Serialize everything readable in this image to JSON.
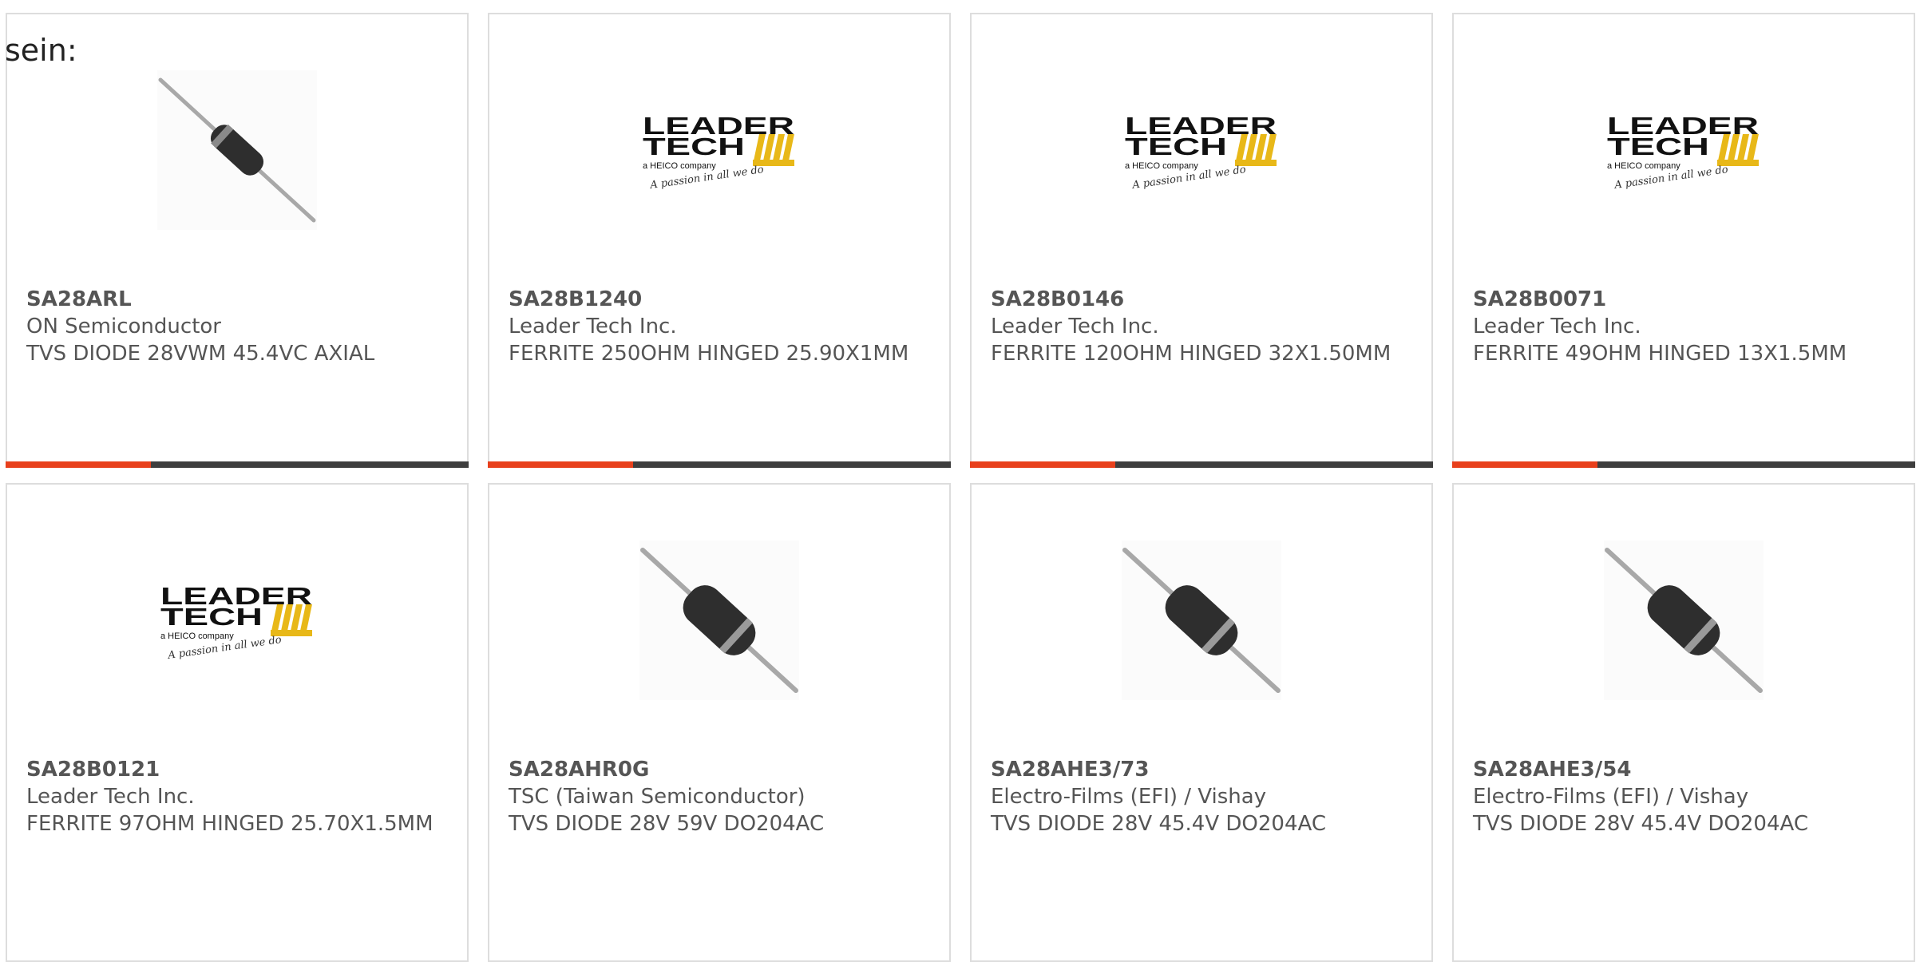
{
  "page": {
    "heading": "sein:"
  },
  "colors": {
    "accent": "#e8401c",
    "bar": "#3e3e3e",
    "card_border": "#dddddd",
    "text": "#555555",
    "leader_tech_yellow": "#e8b818"
  },
  "products": [
    {
      "part_number": "SA28ARL",
      "manufacturer": "ON Semiconductor",
      "description": "TVS DIODE 28VWM 45.4VC AXIAL",
      "image": "axial-diode-thin"
    },
    {
      "part_number": "SA28B1240",
      "manufacturer": "Leader Tech Inc.",
      "description": "FERRITE 250OHM HINGED 25.90X1MM",
      "image": "leader-tech-logo",
      "logo": {
        "line1": "LEADER",
        "line2": "TECH",
        "sub": "a HEICO company",
        "tagline": "A passion in all we do"
      }
    },
    {
      "part_number": "SA28B0146",
      "manufacturer": "Leader Tech Inc.",
      "description": "FERRITE 120OHM HINGED 32X1.50MM",
      "image": "leader-tech-logo",
      "logo": {
        "line1": "LEADER",
        "line2": "TECH",
        "sub": "a HEICO company",
        "tagline": "A passion in all we do"
      }
    },
    {
      "part_number": "SA28B0071",
      "manufacturer": "Leader Tech Inc.",
      "description": "FERRITE 49OHM HINGED 13X1.5MM",
      "image": "leader-tech-logo",
      "logo": {
        "line1": "LEADER",
        "line2": "TECH",
        "sub": "a HEICO company",
        "tagline": "A passion in all we do"
      }
    },
    {
      "part_number": "SA28B0121",
      "manufacturer": "Leader Tech Inc.",
      "description": "FERRITE 97OHM HINGED 25.70X1.5MM",
      "image": "leader-tech-logo",
      "logo": {
        "line1": "LEADER",
        "line2": "TECH",
        "sub": "a HEICO company",
        "tagline": "A passion in all we do"
      }
    },
    {
      "part_number": "SA28AHR0G",
      "manufacturer": "TSC (Taiwan Semiconductor)",
      "description": "TVS DIODE 28V 59V DO204AC",
      "image": "axial-diode-thick"
    },
    {
      "part_number": "SA28AHE3/73",
      "manufacturer": "Electro-Films (EFI) / Vishay",
      "description": "TVS DIODE 28V 45.4V DO204AC",
      "image": "axial-diode-thick"
    },
    {
      "part_number": "SA28AHE3/54",
      "manufacturer": "Electro-Films (EFI) / Vishay",
      "description": "TVS DIODE 28V 45.4V DO204AC",
      "image": "axial-diode-thick"
    }
  ]
}
